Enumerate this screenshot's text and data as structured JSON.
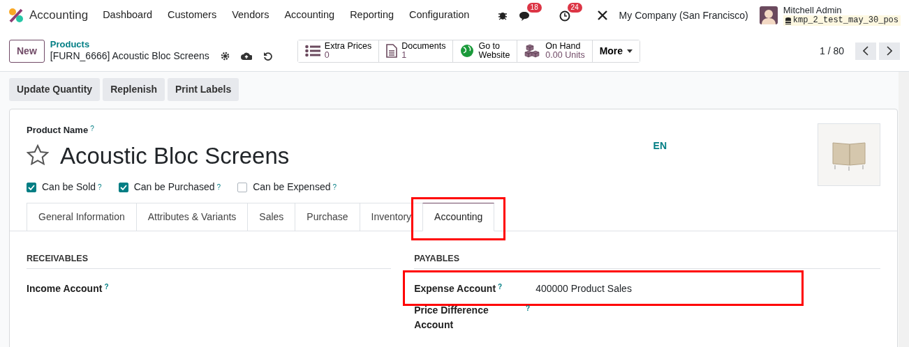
{
  "navbar": {
    "app": "Accounting",
    "menu": [
      "Dashboard",
      "Customers",
      "Vendors",
      "Accounting",
      "Reporting",
      "Configuration"
    ],
    "messages_count": "18",
    "activities_count": "24",
    "company": "My Company (San Francisco)",
    "user": "Mitchell Admin",
    "database": "kmp_2_test_may_30_pos"
  },
  "control_panel": {
    "new_button": "New",
    "breadcrumb": "Products",
    "record": "[FURN_6666] Acoustic Bloc Screens",
    "smart_buttons": [
      {
        "kind": "list",
        "label": "Extra Prices",
        "value": "0"
      },
      {
        "kind": "document",
        "label": "Documents",
        "value": "1"
      },
      {
        "kind": "globe",
        "label": "Go to",
        "value": "Website"
      },
      {
        "kind": "boxes",
        "label": "On Hand",
        "value": "0.00 Units"
      },
      {
        "kind": "more",
        "label": "More"
      }
    ],
    "pager": "1 / 80"
  },
  "actions": [
    "Update Quantity",
    "Replenish",
    "Print Labels"
  ],
  "form": {
    "name_label": "Product Name",
    "name_help": "?",
    "name": "Acoustic Bloc Screens",
    "favorite": false,
    "language": "EN",
    "options": [
      {
        "label": "Can be Sold",
        "help": "?",
        "checked": true
      },
      {
        "label": "Can be Purchased",
        "help": "?",
        "checked": true
      },
      {
        "label": "Can be Expensed",
        "help": "?",
        "checked": false
      }
    ],
    "tabs": [
      {
        "label": "General Information",
        "selected": false,
        "highlighted": false
      },
      {
        "label": "Attributes & Variants",
        "selected": false,
        "highlighted": false
      },
      {
        "label": "Sales",
        "selected": false,
        "highlighted": false
      },
      {
        "label": "Purchase",
        "selected": false,
        "highlighted": false
      },
      {
        "label": "Inventory",
        "selected": false,
        "highlighted": false
      },
      {
        "label": "Accounting",
        "selected": true,
        "highlighted": true
      }
    ],
    "groups": [
      {
        "title": "RECEIVABLES",
        "fields": [
          {
            "label": "Income Account",
            "help": "?",
            "highlighted": false
          }
        ]
      },
      {
        "title": "PAYABLES",
        "fields": [
          {
            "label": "Expense Account",
            "help": "?",
            "value": "400000 Product Sales",
            "highlighted": true
          },
          {
            "label": "Price Difference Account",
            "help": "?",
            "highlighted": false
          }
        ]
      }
    ]
  }
}
